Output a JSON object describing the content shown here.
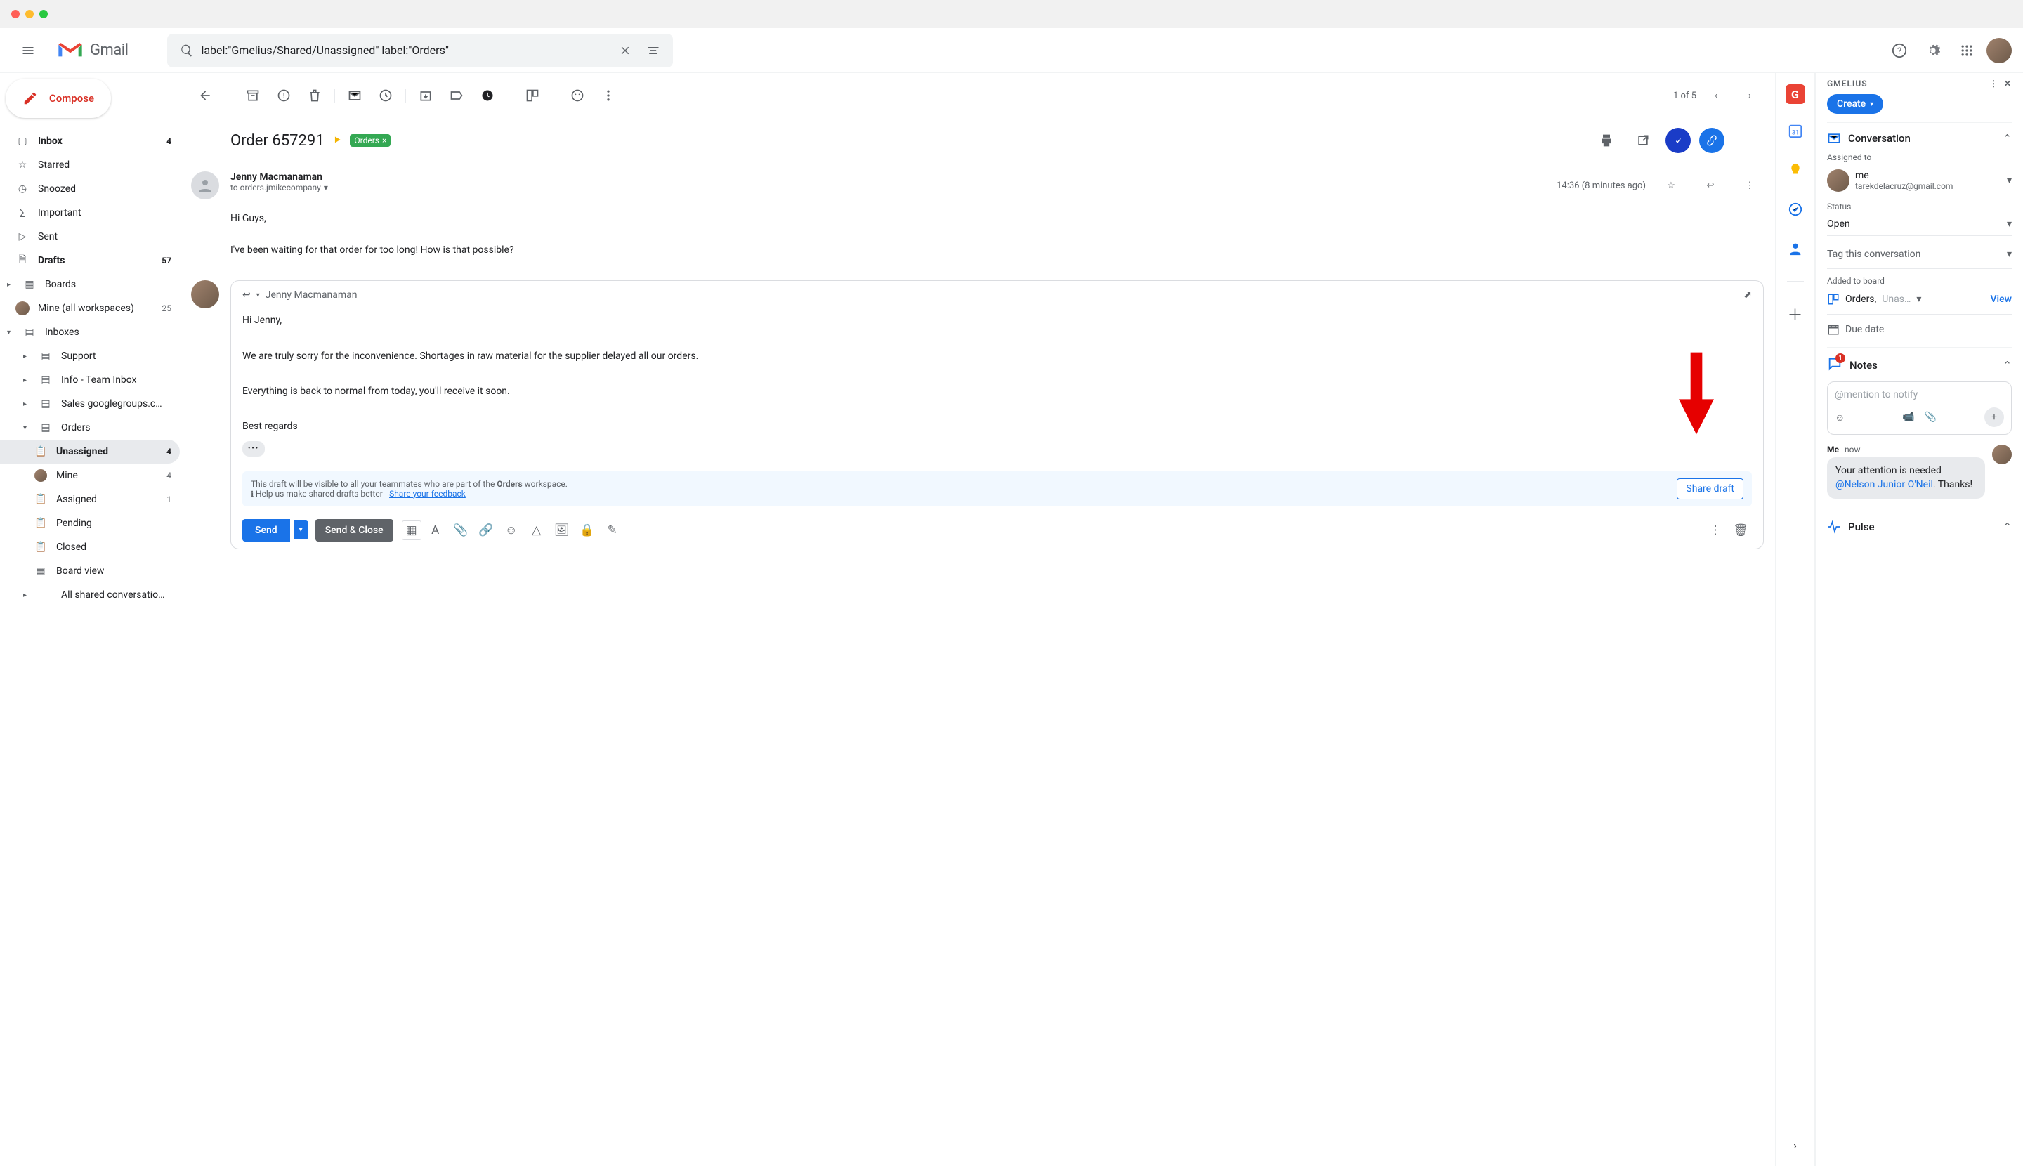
{
  "window": {
    "title": "Gmail"
  },
  "search": {
    "value": "label:\"Gmelius/Shared/Unassigned\" label:\"Orders\""
  },
  "compose": {
    "label": "Compose"
  },
  "sidebar": {
    "items": [
      {
        "label": "Inbox",
        "count": "4",
        "icon": "inbox-icon",
        "bold": true
      },
      {
        "label": "Starred",
        "icon": "star-icon"
      },
      {
        "label": "Snoozed",
        "icon": "clock-icon"
      },
      {
        "label": "Important",
        "icon": "important-icon"
      },
      {
        "label": "Sent",
        "icon": "send-icon"
      },
      {
        "label": "Drafts",
        "count": "57",
        "icon": "draft-icon",
        "bold": true
      },
      {
        "label": "Boards",
        "icon": "board-icon",
        "expandable": true
      },
      {
        "label": "Mine (all workspaces)",
        "count": "25",
        "icon": "avatar-icon"
      },
      {
        "label": "Inboxes",
        "icon": "inbox-group-icon",
        "expandable": true,
        "expanded": true
      }
    ],
    "sub_inboxes": [
      {
        "label": "Support",
        "icon": "label-icon",
        "expandable": true
      },
      {
        "label": "Info - Team Inbox",
        "icon": "label-icon",
        "expandable": true
      },
      {
        "label": "Sales googlegroups.c…",
        "icon": "label-icon",
        "expandable": true
      },
      {
        "label": "Orders",
        "icon": "label-icon",
        "expandable": true,
        "expanded": true
      }
    ],
    "orders_children": [
      {
        "label": "Unassigned",
        "count": "4",
        "icon": "clipboard-icon",
        "active": true,
        "bold": true
      },
      {
        "label": "Mine",
        "count": "4",
        "icon": "avatar-icon"
      },
      {
        "label": "Assigned",
        "count": "1",
        "icon": "assigned-icon"
      },
      {
        "label": "Pending",
        "icon": "pending-icon"
      },
      {
        "label": "Closed",
        "icon": "closed-icon"
      },
      {
        "label": "Board view",
        "icon": "board-icon"
      }
    ],
    "all_shared": {
      "label": "All shared conversatio…"
    }
  },
  "toolbar": {
    "pager": "1 of 5"
  },
  "email": {
    "subject": "Order 657291",
    "label": "Orders",
    "sender": "Jenny Macmanaman",
    "to": "to orders.jmikecompany",
    "time": "14:36 (8 minutes ago)",
    "body_line1": "Hi Guys,",
    "body_line2": "I've been waiting for that order for too long! How is that possible?"
  },
  "reply": {
    "to": "Jenny Macmanaman",
    "line1": "Hi Jenny,",
    "line2": "We are truly sorry for the inconvenience. Shortages in raw material for the supplier delayed all our orders.",
    "line3": "Everything is back to normal from today, you'll receive it soon.",
    "line4": "Best regards",
    "banner_prefix": "This draft will be visible to all your teammates who are part of the ",
    "banner_workspace": "Orders",
    "banner_suffix": " workspace.",
    "banner_help": "Help us make shared drafts better - ",
    "banner_link": "Share your feedback",
    "share_draft": "Share draft",
    "send": "Send",
    "send_close": "Send & Close"
  },
  "gmelius": {
    "brand": "GMELIUS",
    "create": "Create",
    "conversation": "Conversation",
    "assigned_to_label": "Assigned to",
    "assignee_name": "me",
    "assignee_email": "tarekdelacruz@gmail.com",
    "status_label": "Status",
    "status_value": "Open",
    "tag_label": "Tag this conversation",
    "added_board_label": "Added to board",
    "board_name": "Orders,",
    "board_col": "Unas…",
    "view": "View",
    "due_date": "Due date",
    "notes": "Notes",
    "notes_placeholder": "@mention to notify",
    "note_author": "Me",
    "note_time": "now",
    "note_text1": "Your attention is needed ",
    "note_mention": "@Nelson Junior O'Neil",
    "note_text2": ". Thanks!",
    "pulse": "Pulse"
  }
}
